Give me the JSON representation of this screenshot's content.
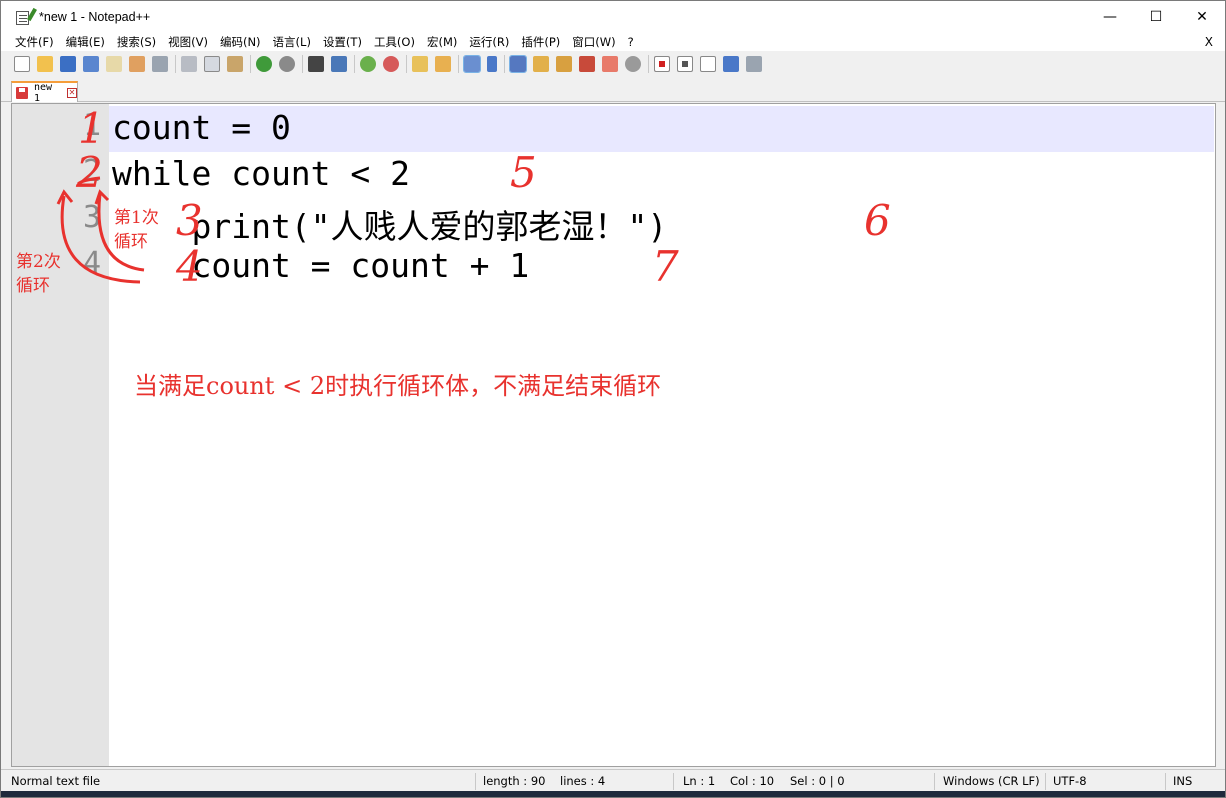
{
  "window": {
    "title": "*new 1 - Notepad++",
    "controls": {
      "minimize": "—",
      "maximize": "☐",
      "close": "✕"
    }
  },
  "menu": {
    "items": [
      "文件(F)",
      "编辑(E)",
      "搜索(S)",
      "视图(V)",
      "编码(N)",
      "语言(L)",
      "设置(T)",
      "工具(O)",
      "宏(M)",
      "运行(R)",
      "插件(P)",
      "窗口(W)",
      "?"
    ],
    "close_label": "X"
  },
  "toolbar": {
    "icons": [
      "new-file-icon",
      "open-file-icon",
      "save-icon",
      "save-all-icon",
      "close-icon",
      "close-all-icon",
      "print-icon",
      "cut-icon",
      "copy-icon",
      "paste-icon",
      "undo-icon",
      "redo-icon",
      "find-icon",
      "replace-icon",
      "zoom-in-icon",
      "zoom-out-icon",
      "sync-vertical-icon",
      "sync-horizontal-icon",
      "word-wrap-icon",
      "show-all-chars-icon",
      "indent-guide-icon",
      "doc-map-icon",
      "function-list-icon",
      "folder-workspace-icon",
      "monitoring-icon",
      "record-macro-icon",
      "stop-macro-icon",
      "play-macro-icon",
      "run-macro-multiple-icon",
      "save-macro-icon"
    ]
  },
  "tabs": [
    {
      "label": "new 1"
    }
  ],
  "editor": {
    "line_numbers": [
      "1",
      "2",
      "3",
      "4"
    ],
    "lines": [
      "count = 0",
      "while count < 2",
      "    print(\"人贱人爱的郭老湿！\")",
      "    count = count + 1"
    ]
  },
  "annotations": {
    "step_numbers": [
      "1",
      "2",
      "3",
      "4",
      "5",
      "6",
      "7"
    ],
    "loop1_label": "第1次\n循环",
    "loop2_label": "第2次\n循环",
    "note": "当满足count < 2时执行循环体，不满足结束循环",
    "color": "#e8322e"
  },
  "status": {
    "file_type": "Normal text file",
    "length": "length : 90",
    "lines": "lines : 4",
    "ln": "Ln : 1",
    "col": "Col : 10",
    "sel": "Sel : 0 | 0",
    "eol": "Windows (CR LF)",
    "encoding": "UTF-8",
    "mode": "INS"
  }
}
